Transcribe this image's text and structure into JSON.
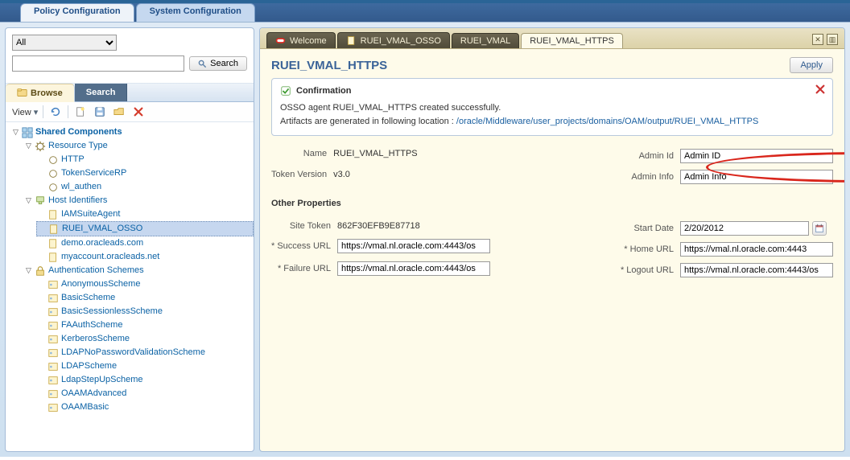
{
  "topTabs": {
    "policy": "Policy Configuration",
    "system": "System Configuration"
  },
  "filter": {
    "all": "All",
    "searchBtn": "Search",
    "placeholder": ""
  },
  "subtabs": {
    "browse": "Browse",
    "search": "Search"
  },
  "toolbar": {
    "view": "View"
  },
  "tree": {
    "shared": "Shared Components",
    "resourceType": "Resource Type",
    "http": "HTTP",
    "tokenServiceRP": "TokenServiceRP",
    "wl_authen": "wl_authen",
    "hostIdentifiers": "Host Identifiers",
    "iamSuite": "IAMSuiteAgent",
    "ruei_vmal_osso": "RUEI_VMAL_OSSO",
    "demo_oracleads": "demo.oracleads.com",
    "myaccount": "myaccount.oracleads.net",
    "authSchemes": "Authentication Schemes",
    "anonymous": "AnonymousScheme",
    "basic": "BasicScheme",
    "basicSessionless": "BasicSessionlessScheme",
    "faauth": "FAAuthScheme",
    "kerberos": "KerberosScheme",
    "ldapNoPwd": "LDAPNoPasswordValidationScheme",
    "ldap": "LDAPScheme",
    "ldapStepUp": "LdapStepUpScheme",
    "oaamAdv": "OAAMAdvanced",
    "oaamBasic": "OAAMBasic"
  },
  "rightTabs": {
    "welcome": "Welcome",
    "ruei_osso": "RUEI_VMAL_OSSO",
    "ruei_vmal": "RUEI_VMAL",
    "ruei_https": "RUEI_VMAL_HTTPS"
  },
  "pageTitle": "RUEI_VMAL_HTTPS",
  "applyBtn": "Apply",
  "confirmation": {
    "head": "Confirmation",
    "line1": "OSSO agent RUEI_VMAL_HTTPS created successfully.",
    "line2_prefix": "Artifacts are generated in following location : ",
    "line2_path": "/oracle/Middleware/user_projects/domains/OAM/output/RUEI_VMAL_HTTPS"
  },
  "form": {
    "nameLbl": "Name",
    "nameVal": "RUEI_VMAL_HTTPS",
    "tokenLbl": "Token Version",
    "tokenVal": "v3.0",
    "adminIdLbl": "Admin Id",
    "adminIdVal": "Admin ID",
    "adminInfoLbl": "Admin Info",
    "adminInfoVal": "Admin Info",
    "otherProps": "Other Properties",
    "siteTokenLbl": "Site Token",
    "siteTokenVal": "862F30EFB9E87718",
    "successUrlLbl": "Success URL",
    "successUrlVal": "https://vmal.nl.oracle.com:4443/os",
    "failureUrlLbl": "Failure URL",
    "failureUrlVal": "https://vmal.nl.oracle.com:4443/os",
    "startDateLbl": "Start Date",
    "startDateVal": "2/20/2012",
    "homeUrlLbl": "Home URL",
    "homeUrlVal": "https://vmal.nl.oracle.com:4443",
    "logoutUrlLbl": "Logout URL",
    "logoutUrlVal": "https://vmal.nl.oracle.com:4443/os"
  }
}
